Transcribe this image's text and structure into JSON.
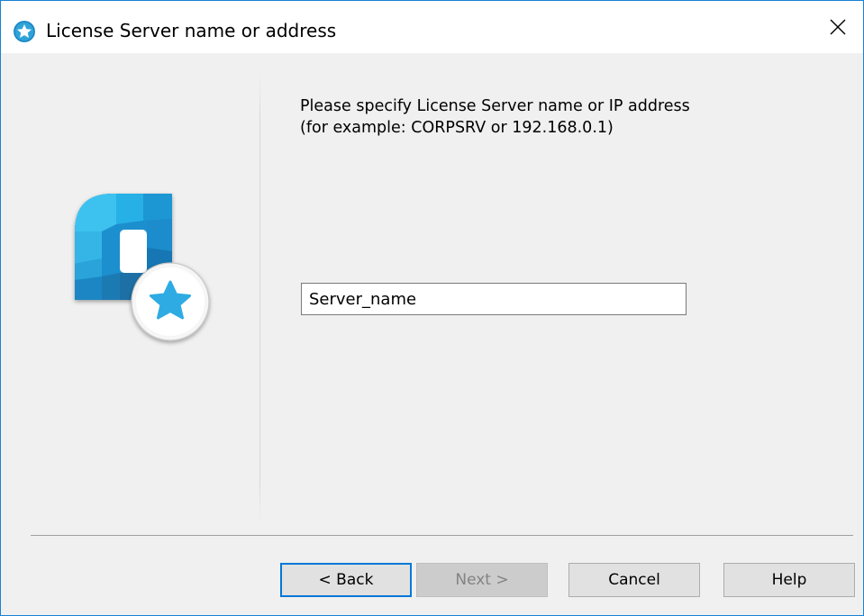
{
  "window": {
    "title": "License Server name or address",
    "accent_color": "#1883d7",
    "app_icon": "star-badge-icon",
    "close_icon": "close-icon"
  },
  "content": {
    "instruction_line1": "Please specify License Server name or IP address",
    "instruction_line2": "(for example: CORPSRV or 192.168.0.1)",
    "server_input_value": "Server_name",
    "logo_icon": "license-server-logo-icon"
  },
  "buttons": {
    "back": "< Back",
    "next": "Next >",
    "cancel": "Cancel",
    "help": "Help"
  }
}
